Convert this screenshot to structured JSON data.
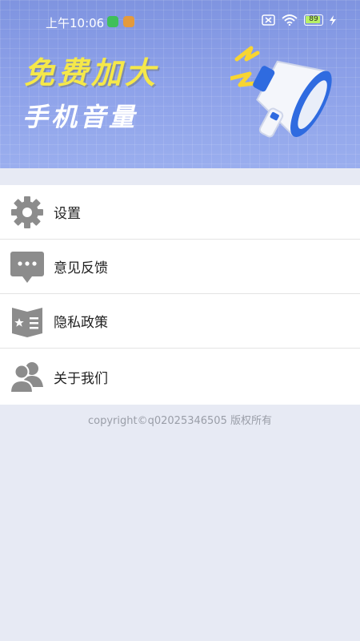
{
  "status_bar": {
    "time": "上午10:06",
    "battery": "89"
  },
  "banner": {
    "headline": "免费加大",
    "subline": "手机音量"
  },
  "menu": {
    "items": [
      {
        "label": "设置",
        "icon": "gear-icon"
      },
      {
        "label": "意见反馈",
        "icon": "chat-bubble-icon"
      },
      {
        "label": "隐私政策",
        "icon": "privacy-book-icon"
      },
      {
        "label": "关于我们",
        "icon": "users-icon"
      }
    ]
  },
  "footer": {
    "copyright": "copyright©q02025346505 版权所有"
  },
  "colors": {
    "banner": "#8fa3ea",
    "headline": "#f5e84a",
    "icon_gray": "#8c8c8c",
    "background": "#e7eaf4"
  }
}
